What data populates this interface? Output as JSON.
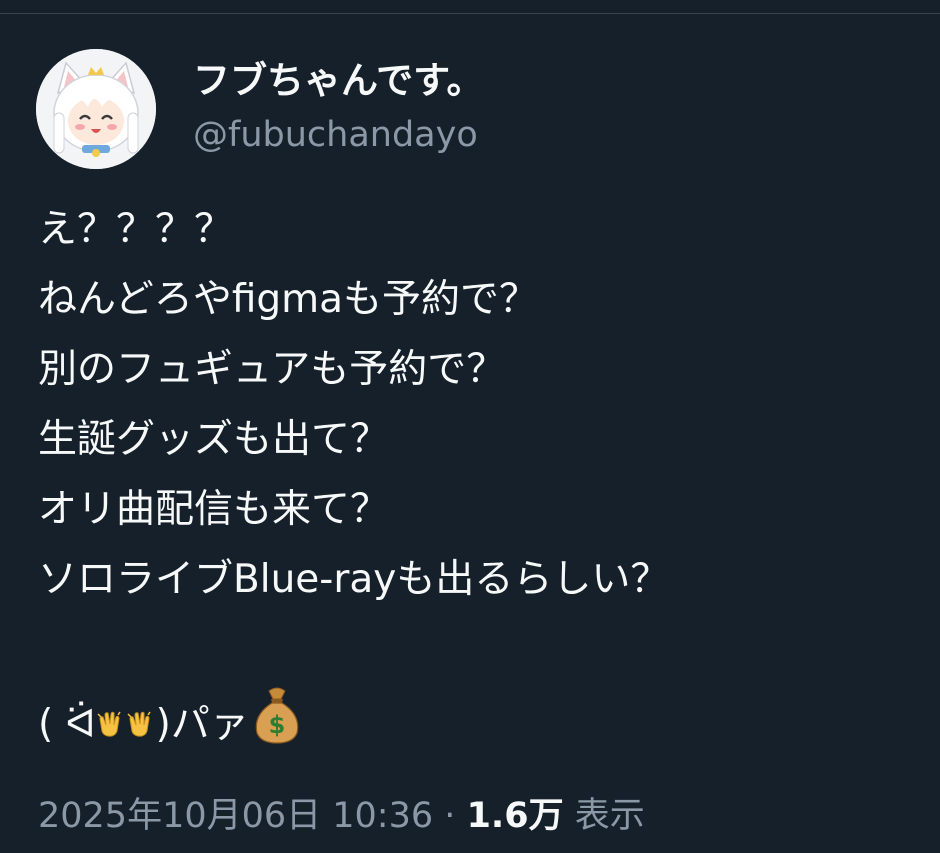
{
  "author": {
    "display_name": "フブちゃんです。",
    "handle": "@fubuchandayo",
    "avatar_icon": "avatar-white-fox-girl-icon"
  },
  "tweet": {
    "lines": [
      "え？？？？",
      "ねんどろやfigmaも予約で？",
      "別のフュギュアも予約で？",
      "生誕グッズも出て？",
      "オリ曲配信も来て？",
      "ソロライブBlue-rayも出るらしい？"
    ],
    "kaomoji_open": "( ᐛ",
    "kaomoji_close": ")パァ",
    "emoji": [
      "clapping-hands-icon",
      "clapping-hands-icon",
      "money-bag-icon"
    ]
  },
  "meta": {
    "timestamp": "2025年10月06日 10:36",
    "separator": "·",
    "views_count": "1.6万",
    "views_label": "表示"
  },
  "colors": {
    "background": "#15202b",
    "text_primary": "#f7f9f9",
    "text_secondary": "#8b98a5",
    "divider": "#38444d"
  }
}
